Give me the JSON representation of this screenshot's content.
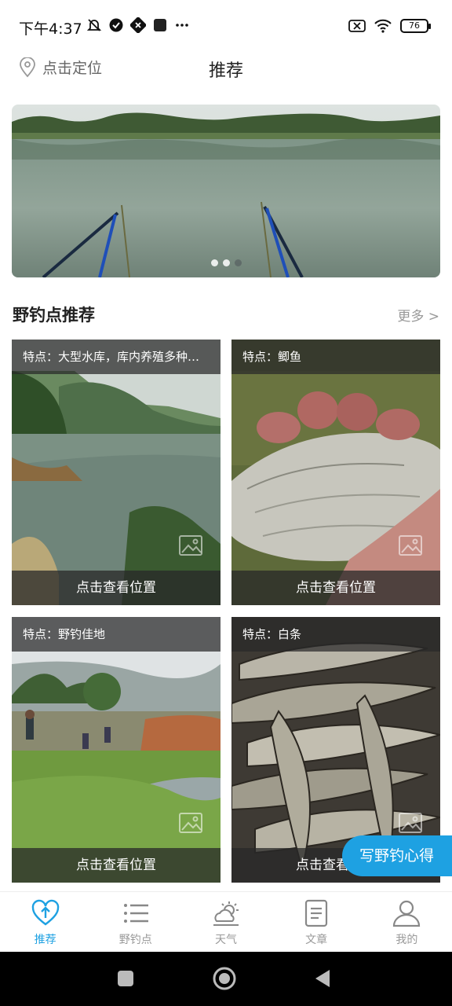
{
  "status_bar": {
    "time": "下午4:37",
    "battery": "76"
  },
  "header": {
    "locate_label": "点击定位",
    "title": "推荐"
  },
  "banner": {
    "slide_count": 3,
    "active_index": 0
  },
  "section": {
    "title": "野钓点推荐",
    "more_label": "更多 >"
  },
  "cards": [
    {
      "feature": "特点：大型水库，库内养殖多种鱼类",
      "action": "点击查看位置",
      "scene": "reservoir"
    },
    {
      "feature": "特点：鲫鱼",
      "action": "点击查看位置",
      "scene": "crucian"
    },
    {
      "feature": "特点：野钓佳地",
      "action": "点击查看位置",
      "scene": "riverside"
    },
    {
      "feature": "特点：白条",
      "action": "点击查看位置",
      "scene": "fish-pile"
    }
  ],
  "fab": {
    "label": "写野钓心得"
  },
  "bottom_nav": [
    {
      "label": "推荐",
      "icon": "heart-arrow-icon",
      "active": true
    },
    {
      "label": "野钓点",
      "icon": "list-icon",
      "active": false
    },
    {
      "label": "天气",
      "icon": "weather-icon",
      "active": false
    },
    {
      "label": "文章",
      "icon": "document-icon",
      "active": false
    },
    {
      "label": "我的",
      "icon": "user-icon",
      "active": false
    }
  ],
  "colors": {
    "accent": "#1ea1e2",
    "muted": "#999999"
  }
}
